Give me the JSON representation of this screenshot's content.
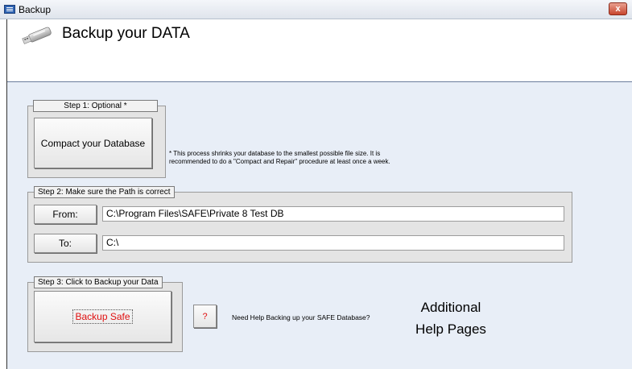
{
  "window": {
    "title": "Backup",
    "icon": "form-window-icon",
    "close_label": "x"
  },
  "header": {
    "title": "Backup your DATA",
    "icon": "usb-drive-icon"
  },
  "step1": {
    "label": "Step 1: Optional *",
    "button_label": "Compact your Database",
    "note_line1": "* This process shrinks your database to the smallest possible file size.  It is",
    "note_line2": "recommended to do a \"Compact and Repair\" procedure at least once a week."
  },
  "step2": {
    "label": "Step 2: Make sure the Path is correct",
    "from_label": "From:",
    "from_value": "C:\\Program Files\\SAFE\\Private 8 Test DB",
    "to_label": "To:",
    "to_value": "C:\\"
  },
  "step3": {
    "label": "Step 3:  Click to Backup your Data",
    "button_label": "Backup Safe"
  },
  "help": {
    "button_label": "?",
    "text": "Need Help Backing up your SAFE Database?",
    "additional_line1": "Additional",
    "additional_line2": "Help Pages"
  },
  "colors": {
    "accent_red": "#e01010",
    "panel_bg": "#e8eef7"
  }
}
